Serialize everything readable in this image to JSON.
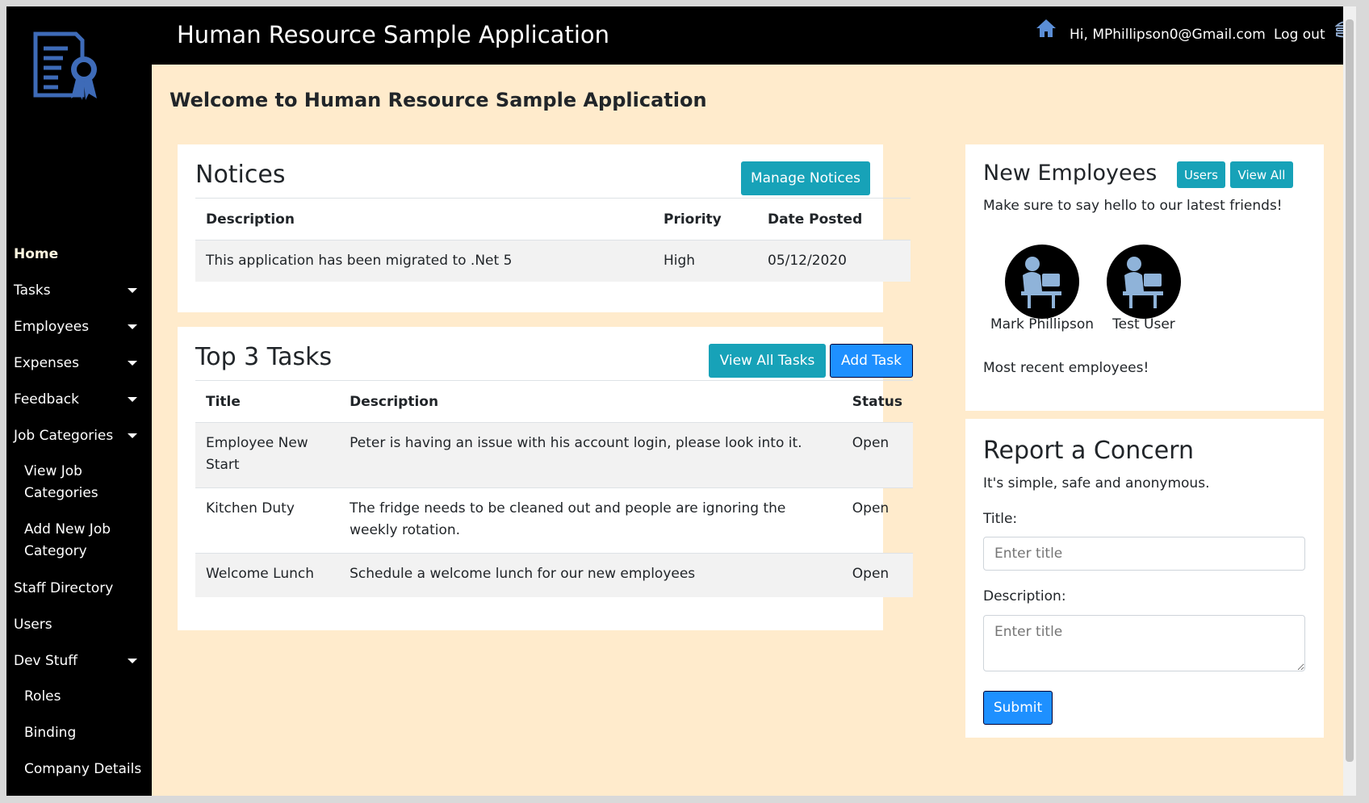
{
  "header": {
    "app_title": "Human Resource Sample Application",
    "greeting": "Hi, MPhillipson0@Gmail.com",
    "logout": "Log out"
  },
  "sidebar": {
    "home": "Home",
    "tasks": "Tasks",
    "employees": "Employees",
    "expenses": "Expenses",
    "feedback": "Feedback",
    "job_categories": "Job Categories",
    "view_job_categories": "View Job Categories",
    "add_job_category": "Add New Job Category",
    "staff_directory": "Staff Directory",
    "users": "Users",
    "dev_stuff": "Dev Stuff",
    "roles": "Roles",
    "binding": "Binding",
    "company_details": "Company Details"
  },
  "main": {
    "welcome": "Welcome to Human Resource Sample Application"
  },
  "notices": {
    "title": "Notices",
    "manage_button": "Manage Notices",
    "columns": [
      "Description",
      "Priority",
      "Date Posted"
    ],
    "rows": [
      {
        "description": "This application has been migrated to .Net 5",
        "priority": "High",
        "date": "05/12/2020"
      }
    ]
  },
  "tasks": {
    "title": "Top 3 Tasks",
    "view_all_button": "View All Tasks",
    "add_button": "Add Task",
    "columns": [
      "Title",
      "Description",
      "Status"
    ],
    "rows": [
      {
        "title": "Employee New Start",
        "description": "Peter is having an issue with his account login, please look into it.",
        "status": "Open"
      },
      {
        "title": "Kitchen Duty",
        "description": "The fridge needs to be cleaned out and people are ignoring the weekly rotation.",
        "status": "Open"
      },
      {
        "title": "Welcome Lunch",
        "description": "Schedule a welcome lunch for our new employees",
        "status": "Open"
      }
    ]
  },
  "new_employees": {
    "title": "New Employees",
    "users_button": "Users",
    "view_all_button": "View All",
    "subtitle": "Make sure to say hello to our latest friends!",
    "people": [
      "Mark Phillipson",
      "Test User"
    ],
    "footer": "Most recent employees!"
  },
  "concern": {
    "title": "Report a Concern",
    "subtitle": "It's simple, safe and anonymous.",
    "title_label": "Title:",
    "title_placeholder": "Enter title",
    "description_label": "Description:",
    "description_placeholder": "Enter title",
    "submit": "Submit"
  }
}
